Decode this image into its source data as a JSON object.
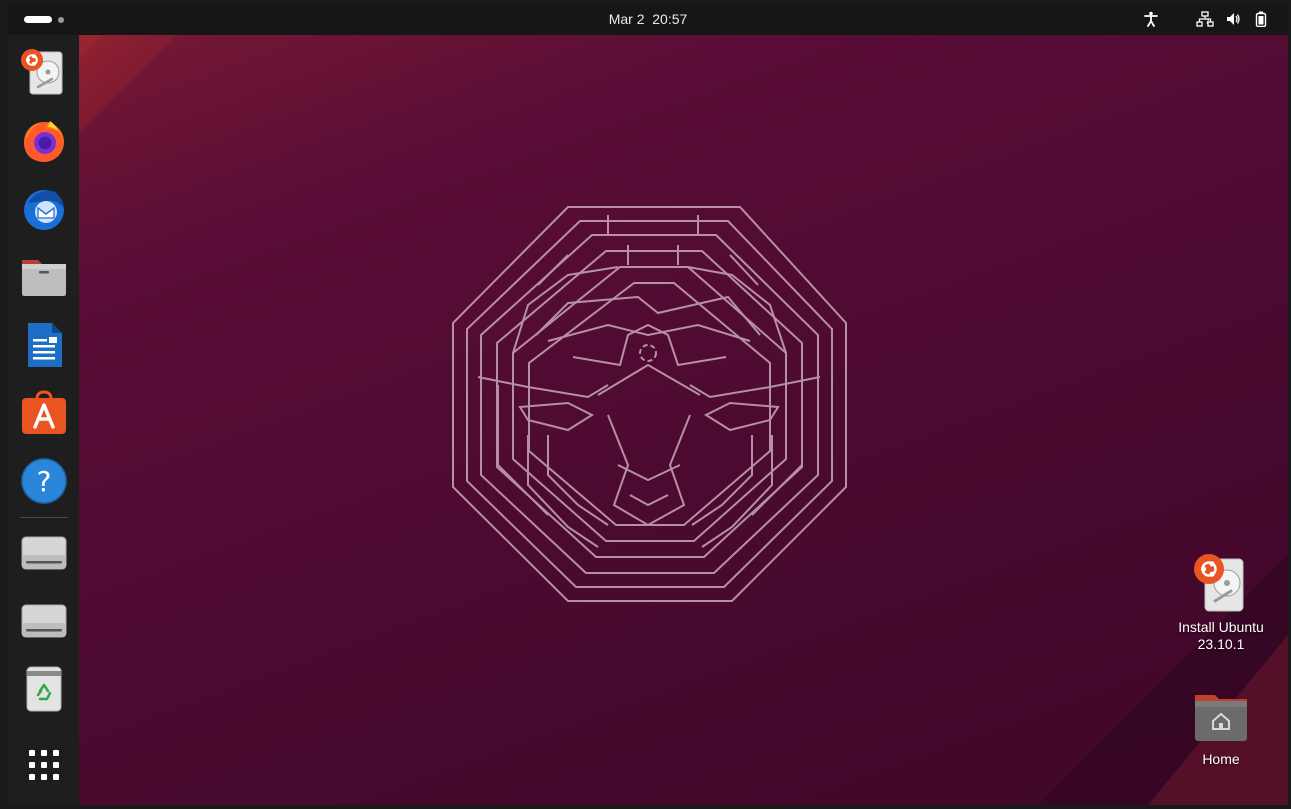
{
  "topbar": {
    "date": "Mar 2",
    "time": "20:57",
    "tray_icons": [
      "accessibility-icon",
      "network-icon",
      "volume-icon",
      "battery-icon"
    ]
  },
  "dock": {
    "items": [
      {
        "name": "install-ubuntu-icon"
      },
      {
        "name": "firefox-icon"
      },
      {
        "name": "thunderbird-icon"
      },
      {
        "name": "files-icon"
      },
      {
        "name": "libreoffice-writer-icon"
      },
      {
        "name": "app-center-icon"
      },
      {
        "name": "help-icon"
      },
      {
        "name": "drive-icon"
      },
      {
        "name": "drive-icon"
      },
      {
        "name": "trash-icon"
      },
      {
        "name": "show-apps-icon"
      }
    ]
  },
  "desktop": {
    "icons": [
      {
        "line1": "Install Ubuntu",
        "line2": "23.10.1"
      },
      {
        "line1": "Home"
      }
    ]
  },
  "colors": {
    "accent": "#e95420",
    "wallpaper": "#4c0a30",
    "panel": "#161616",
    "dock": "#1e1e1e"
  }
}
